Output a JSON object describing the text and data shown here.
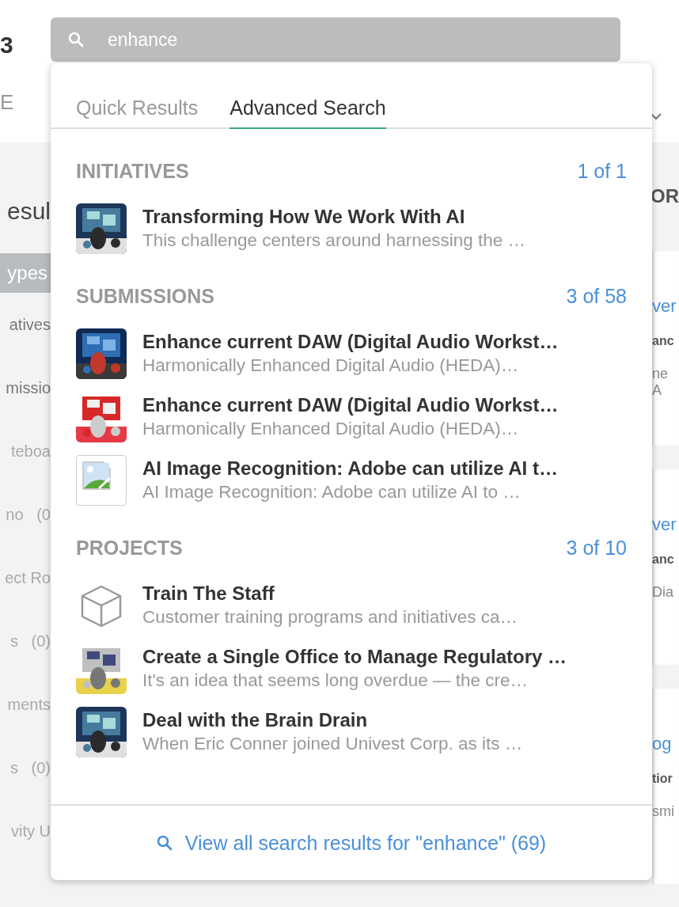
{
  "page": {
    "header_fragments": [
      "3",
      "E"
    ],
    "results_heading": "esul",
    "filter_active": "ypes",
    "filter_items": [
      "atives",
      "missio",
      "teboa",
      "no   (0",
      "ect Ro",
      "s   (0)",
      "ments",
      "s   (0)",
      "vity U"
    ],
    "right_heading": "OR",
    "cards": [
      {
        "title": "ver",
        "subtitle": "anc",
        "text": "ne A"
      },
      {
        "title": "ver",
        "subtitle": "anc",
        "text": "Dia"
      },
      {
        "title": "og",
        "subtitle": "tior",
        "text": "smi"
      }
    ]
  },
  "search": {
    "value": "enhance"
  },
  "dropdown": {
    "tabs": [
      {
        "label": "Quick Results",
        "selected": false
      },
      {
        "label": "Advanced Search",
        "selected": true
      }
    ],
    "sections": [
      {
        "heading": "INITIATIVES",
        "count": "1 of 1",
        "items": [
          {
            "title": "Transforming How We Work With AI",
            "description": "This challenge centers around harnessing the …"
          }
        ]
      },
      {
        "heading": "SUBMISSIONS",
        "count": "3 of 58",
        "items": [
          {
            "title": "Enhance current DAW (Digital Audio Workst…",
            "description": "Harmonically Enhanced Digital Audio (HEDA)…"
          },
          {
            "title": "Enhance current DAW (Digital Audio Workst…",
            "description": "Harmonically Enhanced Digital Audio (HEDA)…"
          },
          {
            "kind": "broken-image",
            "title": "AI Image Recognition: Adobe can utilize AI t…",
            "description": "AI Image Recognition: Adobe can utilize AI to …"
          }
        ]
      },
      {
        "heading": "PROJECTS",
        "count": "3 of 10",
        "items": [
          {
            "kind": "cube",
            "title": "Train The Staff",
            "description": "Customer training programs and initiatives ca…"
          },
          {
            "title": "Create a Single Office to Manage Regulatory …",
            "description": "It's an idea that seems long overdue — the cre…"
          },
          {
            "title": "Deal with the Brain Drain",
            "description": "When Eric Conner joined Univest Corp. as its …"
          }
        ]
      }
    ],
    "footer_link": "View all search results for \"enhance\" (69)"
  }
}
